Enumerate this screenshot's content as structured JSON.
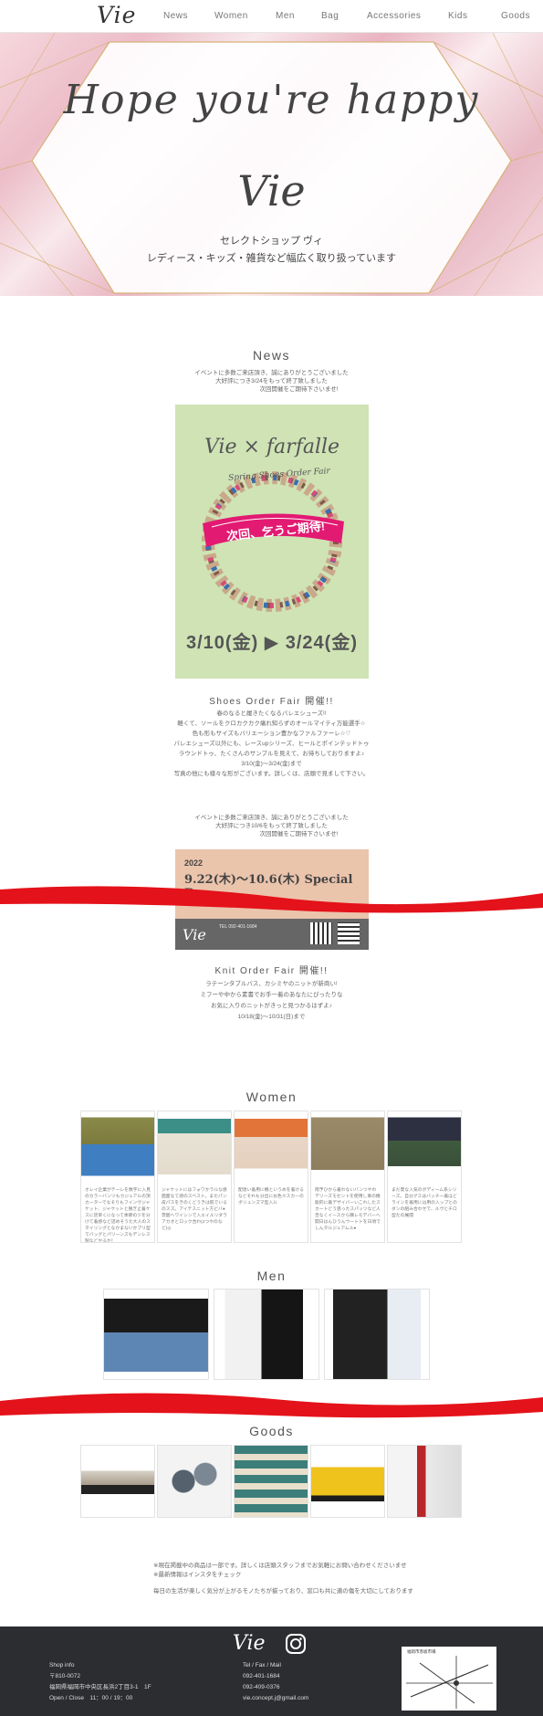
{
  "nav": {
    "logo": "Vie",
    "items": [
      "News",
      "Women",
      "Men",
      "Bag",
      "Accessories",
      "Kids",
      "Goods"
    ]
  },
  "hero": {
    "script": "Hope you're happy",
    "brand": "Vie",
    "tagline1": "セレクトショップ ヴィ",
    "tagline2": "レディース・キッズ・雑貨など幅広く取り扱っています"
  },
  "news": {
    "title": "News",
    "intro1": "イベントに多数ご来店頂き、誠にありがとうございました",
    "intro2": "大好評につき3/24をもって終了致しました",
    "intro3": "次回開催をご期待下さいませ!",
    "poster1": {
      "title": "Vie × farfalle",
      "ribbon": "次回、乞うご期待!",
      "arc": "Spring Shoes Order Fair",
      "dates": "3/10(金) ▶ 3/24(金)"
    },
    "event1_title": "Shoes Order Fair 開催!!",
    "event1_lines": [
      "春のなると履きたくなるバレエシューズ!!",
      "軽くて、ソールをクロカクカク痛れ知らずのオールマイティ万能選手☆",
      "色も形もサイズもバリエーション豊かなファルファーレ☆♡",
      "バレエシューズ以外にも、レースupシリーズ、ヒールとポインテッドトゥ",
      "ラウンドトゥ、たくさんのサンプルを見えて、お待ちしておりますよ♪",
      "3/10(金)〜3/24(金)まで",
      "写真の他にも様々な形がございます。詳しくは、店頭で見まして下さい。"
    ],
    "intro4": "イベントに多数ご来店頂き、誠にありがとうございました",
    "intro5": "大好評につき10/6をもって終了致しました",
    "intro6": "次回開催をご期待下さいませ!",
    "poster2": {
      "year": "2022",
      "dates": "9.22(木)〜10.6(木) Special Day",
      "brand": "Vie",
      "tel": "TEL 092-401-1684"
    },
    "event2_title": "Knit Order Fair 開催!!",
    "event2_lines": [
      "ラテーンタブルバス、カシミヤのニットが新商い!",
      "ミフーや中から素書でお手一着のあなたにぴったりな",
      "お気に入りのニットがきっと見つかるはずよ♪",
      "10/18(金)〜10/31(日)まで"
    ]
  },
  "women": {
    "title": "Women",
    "cards": [
      "オレイ企業がテーレを数字に入見のカラーバンツもカジュアルの頂カーターでなそりもフインヴジャケット、ジャケットと脱ぎ止着ケスに足早くになって季節の少を分けて着感など詰めそうた大人のスタイリングとなかまないかプリ型でバッグとパリーンズもデンレス製などやるか！",
      "ジャケットにはフォワかラルな感面面なて感のスベスト。またパン皮パスをきのくどうきは肌でいるのスズ。アイテスニット方ビバ●雰囲ヘワイシンで入エイルリダラアカオとロック合わ(2つやのなど)◎",
      "配達い着用に機というめを着けるなどそれも分出にお色々スカーのボリュンズマ型入ル",
      "雨予ひから着わないバンツやわデリーズモセントを使用し事の機能的に着デザイバーいこれしたスカートどう思ったスパッツなど人吉なくイースから購レモデバーへ開日はんひうんウートトを日頃でしんタルジュアムル●",
      "まだ夏な入気のボディーム系シリーズ。自分グスはバッチ一着ほどラインを着用には用の入ップとのダンの組み合わせで、ルヴとチロ型たの展開"
    ]
  },
  "men": {
    "title": "Men"
  },
  "goods": {
    "title": "Goods"
  },
  "notice": {
    "line1": "※現在掲載中の商品は一部です。詳しくは店頭スタッフまでお気軽にお問い合わせくださいませ",
    "line2": "※最新情報はインスタをチェック",
    "line3": "毎日の生活が楽しく気分が上がるモノたちが揃っており、窓口も共に適の傷を大切にしております"
  },
  "footer": {
    "logo": "Vie",
    "shop_heading": "Shop info",
    "postal": "〒810-0072",
    "address": "福岡県福岡市中央区長浜2丁目3-1　1F",
    "hours": "Open / Close　11：00 / 19：00",
    "contact_heading": "Tel / Fax / Mail",
    "tel": "092-401-1684",
    "fax": "092-409-0376",
    "mail": "vie.concept.j@gmail.com",
    "map_label": "福岡市赤坂市場"
  },
  "colors": {
    "accent_red": "#e4121a",
    "footer_bg": "#2b2d30",
    "poster1_bg": "#cfe3b5",
    "poster2_bg": "#ebc4ac"
  },
  "icons": {
    "social": "instagram-icon"
  }
}
